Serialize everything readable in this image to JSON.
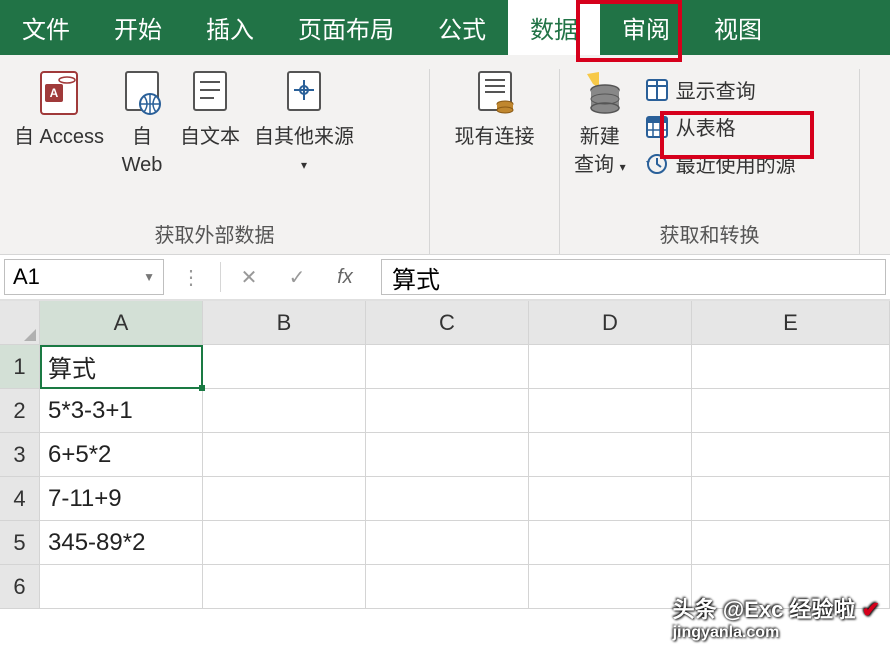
{
  "tabs": {
    "file": "文件",
    "home": "开始",
    "insert": "插入",
    "pagelayout": "页面布局",
    "formulas": "公式",
    "data": "数据",
    "review": "审阅",
    "view": "视图"
  },
  "ribbon": {
    "group1": {
      "access": "自 Access",
      "web_line1": "自",
      "web_line2": "Web",
      "text": "自文本",
      "other": "自其他来源",
      "label": "获取外部数据"
    },
    "group2": {
      "existing": "现有连接"
    },
    "group3": {
      "newquery_line1": "新建",
      "newquery_line2": "查询",
      "showquery": "显示查询",
      "fromtable": "从表格",
      "recent": "最近使用的源",
      "label": "获取和转换"
    }
  },
  "formula_bar": {
    "namebox": "A1",
    "fx": "fx",
    "value": "算式"
  },
  "sheet": {
    "columns": [
      "A",
      "B",
      "C",
      "D",
      "E"
    ],
    "rows": [
      {
        "num": "1",
        "A": "算式"
      },
      {
        "num": "2",
        "A": "5*3-3+1"
      },
      {
        "num": "3",
        "A": "6+5*2"
      },
      {
        "num": "4",
        "A": "7-11+9"
      },
      {
        "num": "5",
        "A": "345-89*2"
      },
      {
        "num": "6",
        "A": ""
      }
    ]
  },
  "watermark": {
    "line1": "头条 @Exc 经验啦",
    "line2": "jingyanla.com"
  }
}
